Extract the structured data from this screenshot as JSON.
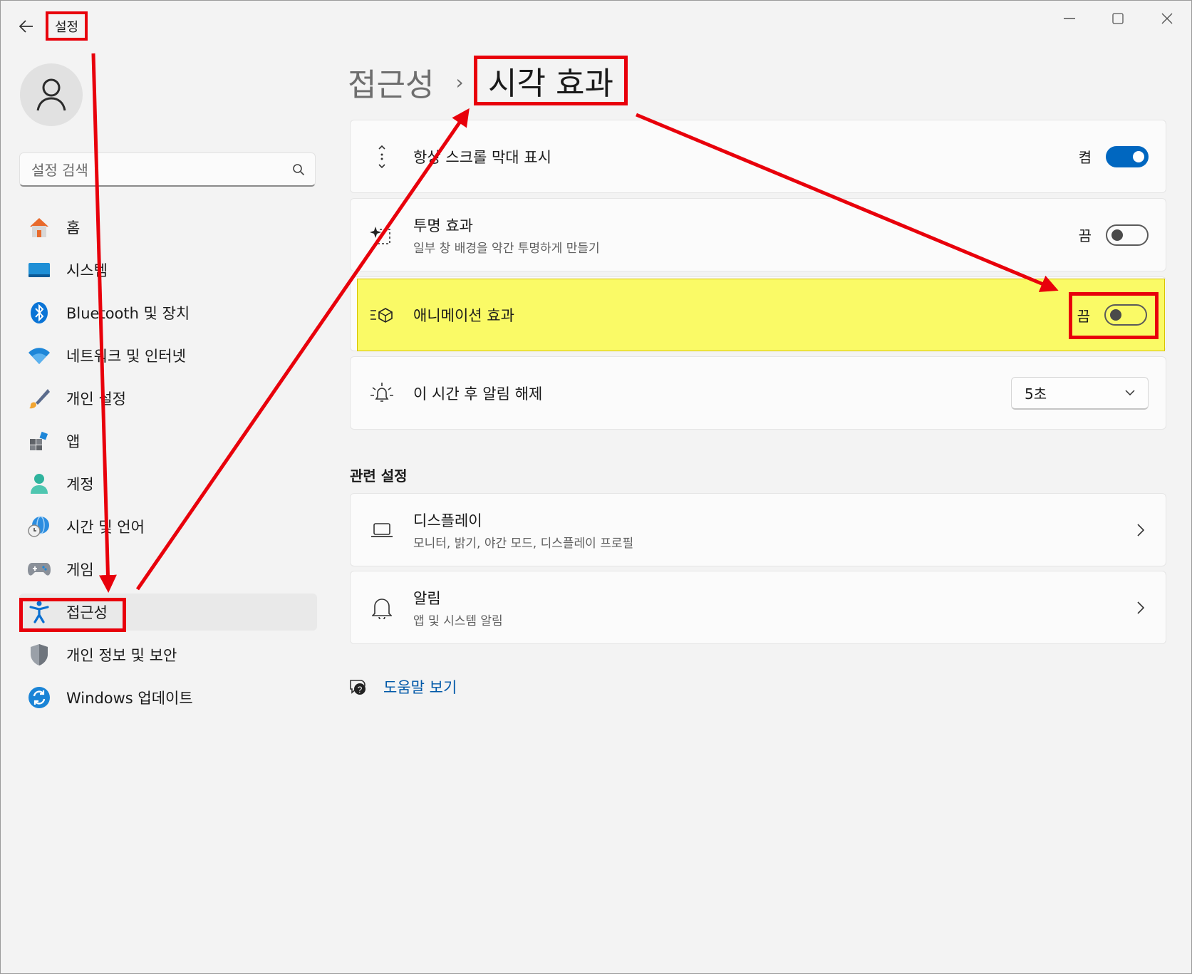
{
  "window": {
    "title": "설정",
    "controls": [
      "minimize",
      "maximize",
      "close"
    ]
  },
  "sidebar": {
    "search_placeholder": "설정 검색",
    "items": [
      {
        "label": "홈",
        "icon": "home-icon"
      },
      {
        "label": "시스템",
        "icon": "system-icon"
      },
      {
        "label": "Bluetooth 및 장치",
        "icon": "bluetooth-icon"
      },
      {
        "label": "네트워크 및 인터넷",
        "icon": "wifi-icon"
      },
      {
        "label": "개인 설정",
        "icon": "brush-icon"
      },
      {
        "label": "앱",
        "icon": "apps-icon"
      },
      {
        "label": "계정",
        "icon": "account-icon"
      },
      {
        "label": "시간 및 언어",
        "icon": "globe-clock-icon"
      },
      {
        "label": "게임",
        "icon": "gamepad-icon"
      },
      {
        "label": "접근성",
        "icon": "accessibility-icon",
        "selected": true
      },
      {
        "label": "개인 정보 및 보안",
        "icon": "shield-icon"
      },
      {
        "label": "Windows 업데이트",
        "icon": "update-icon"
      }
    ]
  },
  "breadcrumb": {
    "parent": "접근성",
    "separator": "›",
    "current": "시각 효과"
  },
  "settings": {
    "scrollbars": {
      "title": "항상 스크롤 막대 표시",
      "state": "켬",
      "on": true
    },
    "transparency": {
      "title": "투명 효과",
      "subtitle": "일부 창 배경을 약간 투명하게 만들기",
      "state": "끔",
      "on": false
    },
    "animation": {
      "title": "애니메이션 효과",
      "state": "끔",
      "on": false,
      "highlight_color": "#fafa66"
    },
    "notification_timeout": {
      "title": "이 시간 후 알림 해제",
      "value": "5초"
    }
  },
  "related": {
    "heading": "관련 설정",
    "items": [
      {
        "title": "디스플레이",
        "subtitle": "모니터, 밝기, 야간 모드, 디스플레이 프로필",
        "icon": "laptop-icon"
      },
      {
        "title": "알림",
        "subtitle": "앱 및 시스템 알림",
        "icon": "bell-icon"
      }
    ]
  },
  "help": {
    "label": "도움말 보기"
  },
  "colors": {
    "accent": "#0067c0",
    "annotation": "#e8000b",
    "link": "#0058a8"
  }
}
